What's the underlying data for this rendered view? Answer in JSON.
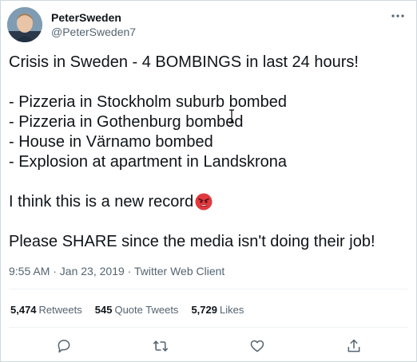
{
  "user": {
    "display_name": "PeterSweden",
    "handle": "@PeterSweden7"
  },
  "tweet": {
    "line1": "Crisis in Sweden - 4 BOMBINGS in last 24 hours!",
    "line2": "- Pizzeria in Stockholm suburb bombed",
    "line3": "- Pizzeria in Gothenburg bombed",
    "line4": "- House in Värnamo bombed",
    "line5": "- Explosion at apartment in Landskrona",
    "line6": "I think this is a new record",
    "line7": "Please SHARE since the media isn't doing their job!"
  },
  "meta": {
    "timestamp": "9:55 AM · Jan 23, 2019 · Twitter Web Client"
  },
  "stats": {
    "retweets_count": "5,474",
    "retweets_label": "Retweets",
    "quotes_count": "545",
    "quotes_label": "Quote Tweets",
    "likes_count": "5,729",
    "likes_label": "Likes"
  },
  "icons": {
    "more": "more-icon",
    "reply": "reply-icon",
    "retweet": "retweet-icon",
    "like": "heart-icon",
    "share": "share-icon",
    "emoji": "angry-face-emoji"
  },
  "colors": {
    "text": "#0f1419",
    "secondary": "#536471",
    "emoji": "#e0393e"
  }
}
